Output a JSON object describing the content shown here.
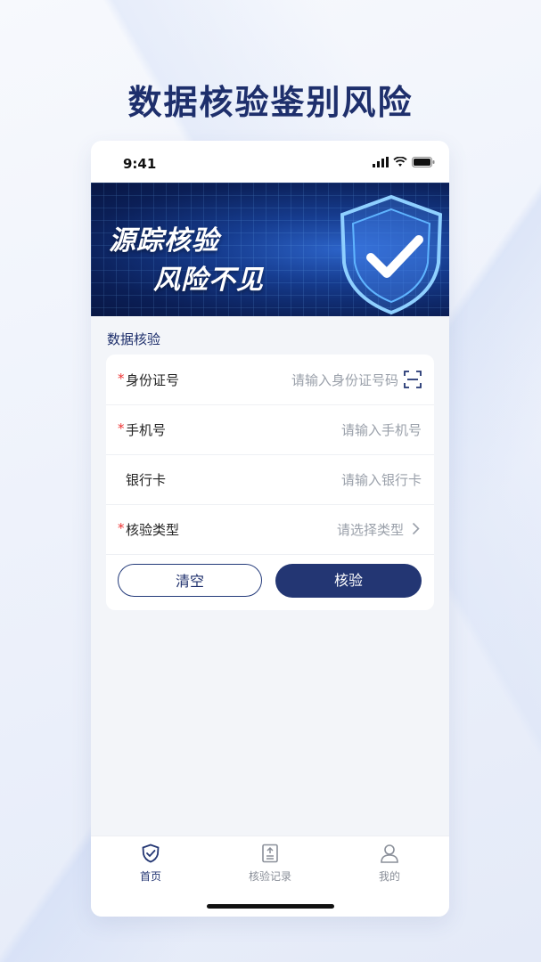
{
  "headline": "数据核验鉴别风险",
  "status": {
    "time": "9:41"
  },
  "banner": {
    "line1": "源踪核验",
    "line2": "风险不见"
  },
  "section_title": "数据核验",
  "form": {
    "rows": [
      {
        "required": true,
        "label": "身份证号",
        "placeholder": "请输入身份证号码",
        "icon": "scan-icon"
      },
      {
        "required": true,
        "label": "手机号",
        "placeholder": "请输入手机号"
      },
      {
        "required": false,
        "label": "银行卡",
        "placeholder": "请输入银行卡"
      },
      {
        "required": true,
        "label": "核验类型",
        "placeholder": "请选择类型",
        "icon": "chevron-right-icon"
      }
    ],
    "required_mark": "*",
    "clear_label": "清空",
    "verify_label": "核验"
  },
  "tabs": [
    {
      "label": "首页",
      "icon": "shield-check-icon",
      "active": true
    },
    {
      "label": "核验记录",
      "icon": "record-icon",
      "active": false
    },
    {
      "label": "我的",
      "icon": "user-icon",
      "active": false
    }
  ],
  "colors": {
    "brand": "#233673",
    "required": "#e33333",
    "placeholder": "#9aa0aa",
    "headline": "#1e2f6c"
  }
}
